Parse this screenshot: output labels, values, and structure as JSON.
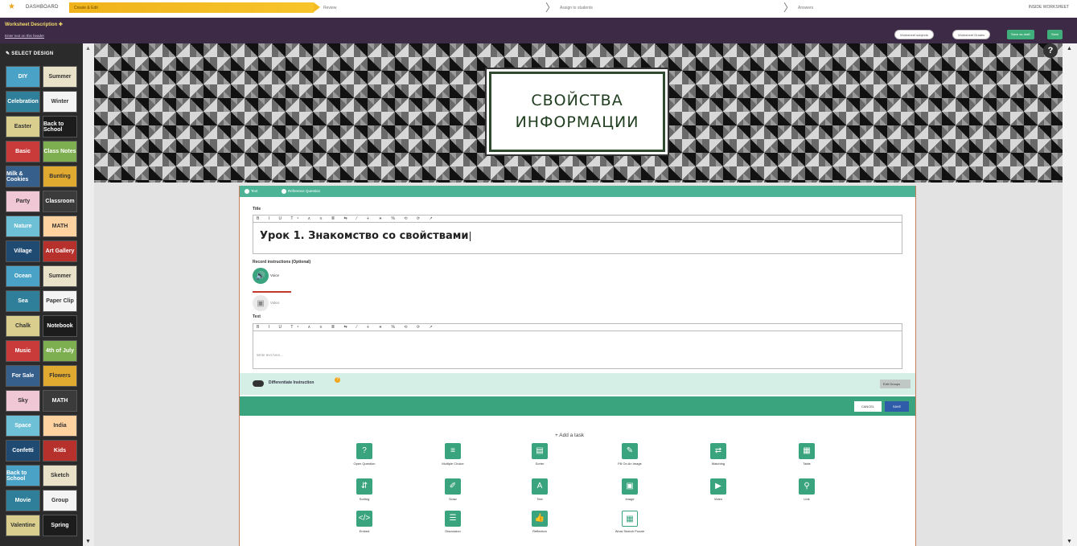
{
  "topbar": {
    "dashboard": "DASHBOARD",
    "steps": [
      "Create & Edit",
      "Review",
      "Assign to students",
      "Answers"
    ],
    "worksheet_status": "INSIDE WORKSHEET"
  },
  "header": {
    "description_label": "Worksheet Description",
    "description_sub": "Enter text on this header",
    "buttons": [
      "Worksheet subjects",
      "Worksheet Grades",
      "Save as draft",
      "Save"
    ]
  },
  "sidebar": {
    "title": "SELECT DESIGN",
    "thumbs": [
      "DIY",
      "Summer",
      "Celebration",
      "Winter",
      "Easter",
      "Back to School",
      "Basic",
      "Class Notes",
      "Milk & Cookies",
      "Bunting",
      "Party",
      "Classroom",
      "Nature",
      "MATH",
      "Village",
      "Art Gallery",
      "Ocean",
      "Summer",
      "Sea",
      "Paper Clip",
      "Chalk",
      "Notebook",
      "Music",
      "4th of July",
      "For Sale",
      "Flowers",
      "Sky",
      "MATH",
      "Space",
      "India",
      "Confetti",
      "Kids",
      "Back to School",
      "Sketch",
      "Movie",
      "Group",
      "Valentine",
      "Spring"
    ]
  },
  "banner": {
    "line1": "СВОЙСТВА",
    "line2": "ИНФОРМАЦИИ",
    "help": "?"
  },
  "editor": {
    "mode_options": [
      "Text",
      "Reference Question"
    ],
    "title_label": "Title",
    "toolbar_glyphs": "B I U Tˢ ∧ ≡ ≣ ⇆ ⁄ ∔ ∗ % ⟲ ⟳ ↗",
    "title_value": "Урок 1. Знакомство со свойствами",
    "record_label": "Record instructions (Optional)",
    "voice_label": "Voice",
    "video_label": "Video",
    "text_label": "Text",
    "text_placeholder": "Write text here...",
    "diff_label": "Differentiate Instruction",
    "diff_q": "?",
    "edit_groups": "Edit Groups",
    "cancel": "Cancel",
    "save": "Save"
  },
  "tasks": {
    "add_task": "+ Add a task",
    "items": [
      {
        "label": "Open Question",
        "glyph": "?"
      },
      {
        "label": "Multiple Choice",
        "glyph": "≡"
      },
      {
        "label": "Sorter",
        "glyph": "▤"
      },
      {
        "label": "Fill On An Image",
        "glyph": "✎"
      },
      {
        "label": "Matching",
        "glyph": "⇄"
      },
      {
        "label": "Table",
        "glyph": "▦"
      },
      {
        "label": "Sorting",
        "glyph": "⇵"
      },
      {
        "label": "Draw",
        "glyph": "✐"
      },
      {
        "label": "Text",
        "glyph": "A"
      },
      {
        "label": "Image",
        "glyph": "▣"
      },
      {
        "label": "Video",
        "glyph": "▶"
      },
      {
        "label": "Link",
        "glyph": "⚲"
      },
      {
        "label": "Embed",
        "glyph": "</>"
      },
      {
        "label": "Discussion",
        "glyph": "☰"
      },
      {
        "label": "Reflection",
        "glyph": "👍"
      },
      {
        "label": "Word Search Puzzle",
        "glyph": "▦"
      }
    ]
  },
  "colors": {
    "header": "#3c2a47",
    "accent_green": "#3aa47f",
    "step_active": "#f4bb22",
    "save_blue": "#2f5ca8"
  }
}
